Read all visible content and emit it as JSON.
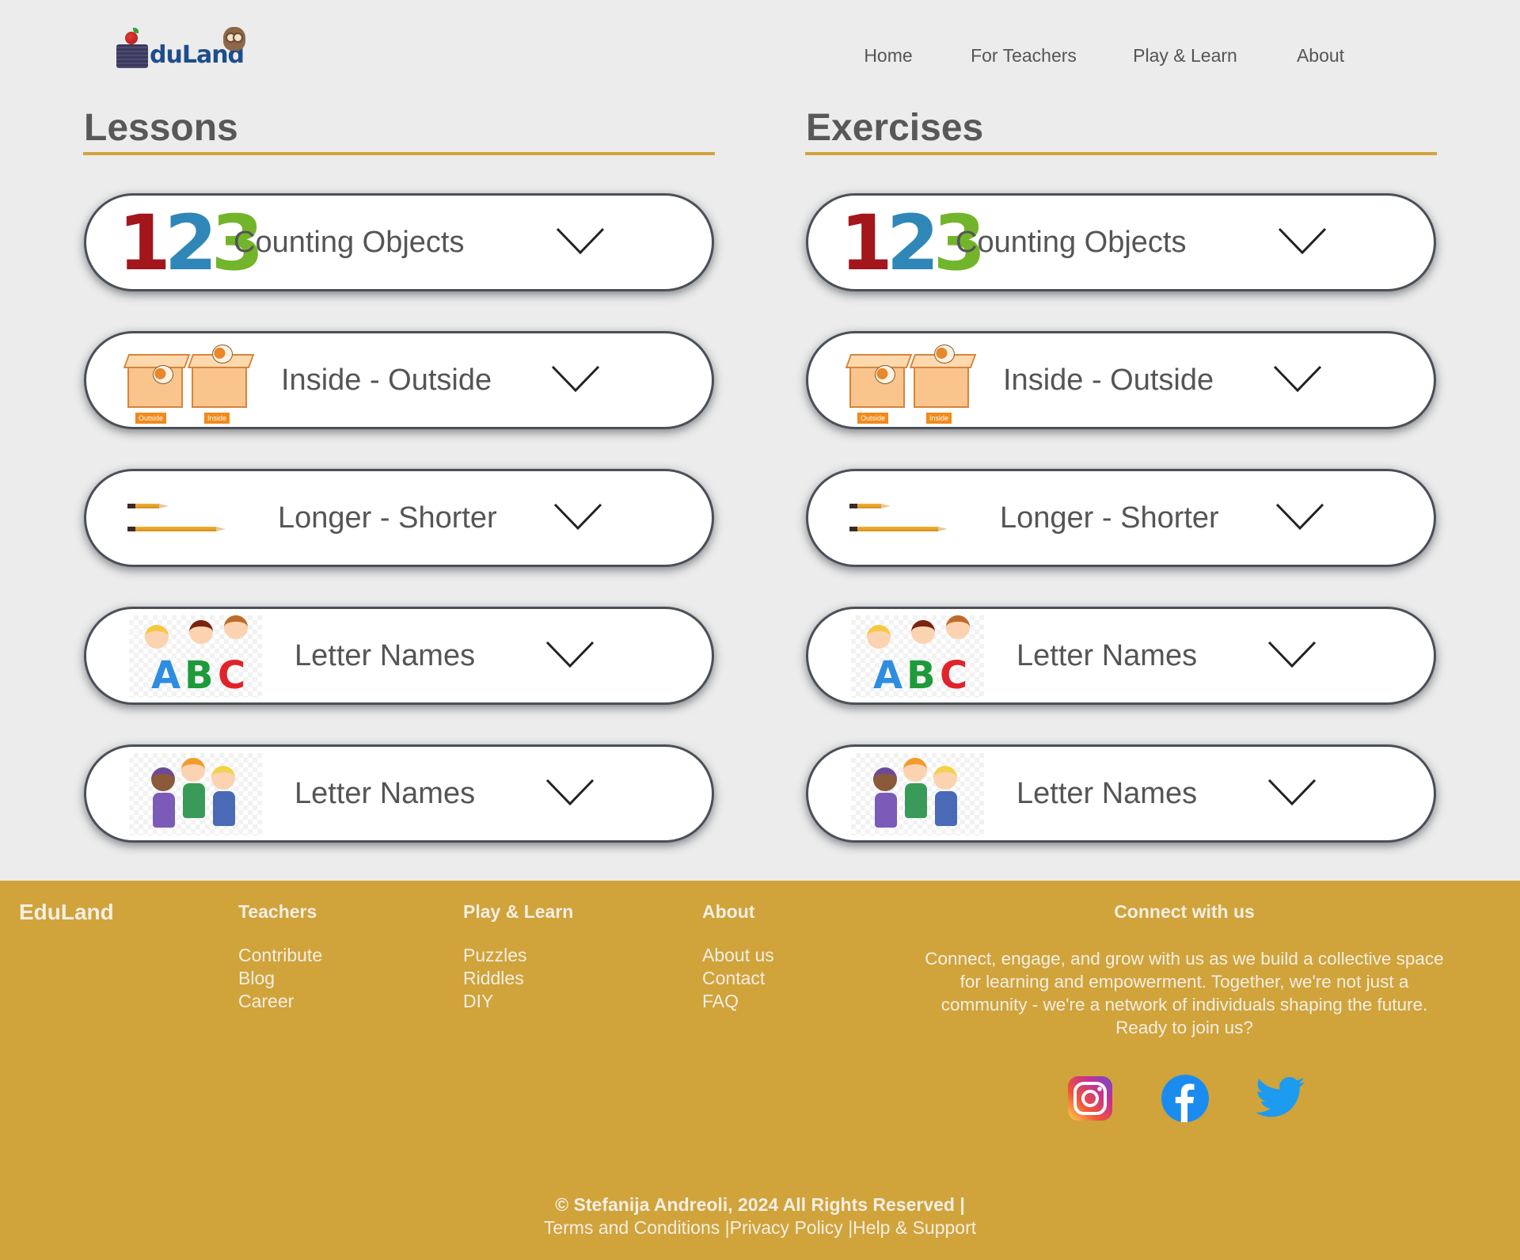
{
  "header": {
    "logo_text": "duLand",
    "nav": [
      {
        "label": "Home"
      },
      {
        "label": "For Teachers"
      },
      {
        "label": "Play & Learn"
      },
      {
        "label": "About"
      }
    ]
  },
  "lessons": {
    "title": "Lessons",
    "items": [
      {
        "label": "Counting Objects",
        "thumb": "numbers-123-image"
      },
      {
        "label": "Inside - Outside",
        "thumb": "cats-in-boxes-image",
        "tags": [
          "Outside",
          "Inside"
        ]
      },
      {
        "label": "Longer - Shorter",
        "thumb": "pencils-image"
      },
      {
        "label": "Letter Names",
        "thumb": "kids-abc-image"
      },
      {
        "label": "Letter Names",
        "thumb": "kids-reading-image"
      }
    ]
  },
  "exercises": {
    "title": "Exercises",
    "items": [
      {
        "label": "Counting Objects",
        "thumb": "numbers-123-image"
      },
      {
        "label": "Inside - Outside",
        "thumb": "cats-in-boxes-image",
        "tags": [
          "Outside",
          "Inside"
        ]
      },
      {
        "label": "Longer - Shorter",
        "thumb": "pencils-image"
      },
      {
        "label": "Letter Names",
        "thumb": "kids-abc-image"
      },
      {
        "label": "Letter Names",
        "thumb": "kids-reading-image"
      }
    ]
  },
  "thumb_text": {
    "digits": [
      "1",
      "2",
      "3"
    ],
    "letters": [
      "A",
      "B",
      "C"
    ]
  },
  "footer": {
    "brand": "EduLand",
    "columns": [
      {
        "heading": "Teachers",
        "links": [
          "Contribute",
          "Blog",
          "Career"
        ]
      },
      {
        "heading": "Play & Learn",
        "links": [
          "Puzzles",
          "Riddles",
          "DIY"
        ]
      },
      {
        "heading": "About",
        "links": [
          "About us",
          "Contact",
          "FAQ"
        ]
      }
    ],
    "connect": {
      "heading": "Connect with us",
      "text": "Connect, engage, and grow with us as we build a collective space for learning and empowerment. Together, we're not just a community - we're a network of individuals shaping the future. Ready to join us?",
      "social": [
        "instagram-icon",
        "facebook-icon",
        "twitter-icon"
      ]
    },
    "copyright": "© Stefanija Andreoli, 2024 All Rights Reserved |",
    "legal_links": [
      "Terms and Conditions",
      "|Privacy Policy",
      "|Help & Support"
    ]
  },
  "colors": {
    "page_bg": "#ececec",
    "accent": "#d0a33b",
    "text": "#555555",
    "card_border": "#4a4f58",
    "logo_blue": "#1e4d8c"
  }
}
